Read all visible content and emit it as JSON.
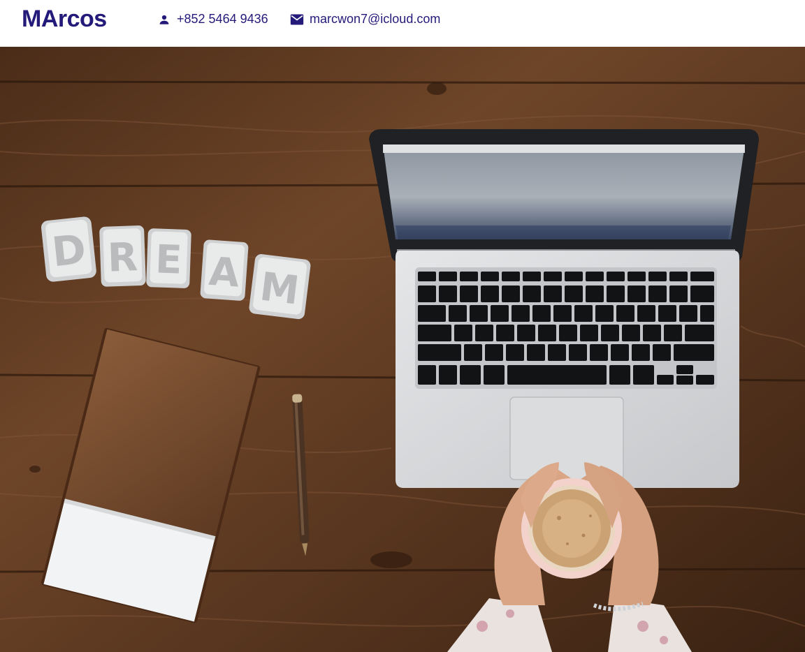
{
  "header": {
    "logo": "MArcos",
    "phone": {
      "icon": "person-icon",
      "text": "+852 5464 9436"
    },
    "email": {
      "icon": "mail-icon",
      "text": "marcwon7@icloud.com"
    }
  },
  "hero": {
    "image_description": "flat-lay desk photo",
    "letters": [
      "D",
      "R",
      "E",
      "A",
      "M"
    ]
  },
  "colors": {
    "brand": "#241a7a",
    "wood_dark": "#3b2314",
    "wood_mid": "#6b4327",
    "laptop_silver": "#d7d9dc"
  }
}
